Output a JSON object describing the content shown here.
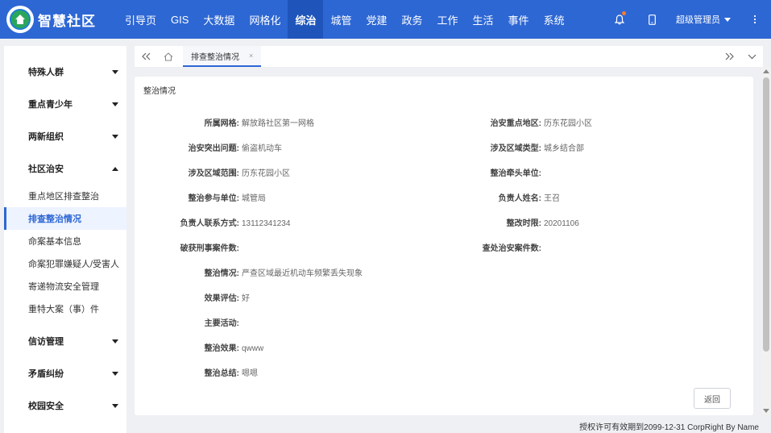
{
  "app": {
    "name": "智慧社区"
  },
  "nav": [
    "引导页",
    "GIS",
    "大数据",
    "网格化",
    "综治",
    "城管",
    "党建",
    "政务",
    "工作",
    "生活",
    "事件",
    "系统"
  ],
  "nav_active": "综治",
  "user": {
    "name": "超级管理员"
  },
  "sidebar": {
    "groups_top": [
      {
        "label": "特殊人群"
      },
      {
        "label": "重点青少年"
      },
      {
        "label": "两新组织"
      }
    ],
    "open_group": {
      "label": "社区治安"
    },
    "sub_items": [
      {
        "label": "重点地区排查整治"
      },
      {
        "label": "排查整治情况"
      },
      {
        "label": "命案基本信息"
      },
      {
        "label": "命案犯罪嫌疑人/受害人"
      },
      {
        "label": "寄递物流安全管理"
      },
      {
        "label": "重特大案（事）件"
      }
    ],
    "active_sub": "排查整治情况",
    "groups_bottom": [
      {
        "label": "信访管理"
      },
      {
        "label": "矛盾纠纷"
      },
      {
        "label": "校园安全"
      }
    ]
  },
  "tab": {
    "label": "排查整治情况",
    "close": "×"
  },
  "card": {
    "title": "整治情况",
    "fields": {
      "grid": {
        "label": "所属网格:",
        "value": "解放路社区第一网格"
      },
      "key_area": {
        "label": "治安重点地区:",
        "value": "历东花园小区"
      },
      "issue": {
        "label": "治安突出问题:",
        "value": "偷盗机动车"
      },
      "area_type": {
        "label": "涉及区域类型:",
        "value": "城乡结合部"
      },
      "area_range": {
        "label": "涉及区域范围:",
        "value": "历东花园小区"
      },
      "lead_unit": {
        "label": "整治牵头单位:",
        "value": ""
      },
      "join_unit": {
        "label": "整治参与单位:",
        "value": "城管局"
      },
      "owner": {
        "label": "负责人姓名:",
        "value": "王召"
      },
      "phone": {
        "label": "负责人联系方式:",
        "value": "13112341234"
      },
      "deadline": {
        "label": "整改时限:",
        "value": "20201106"
      },
      "criminal": {
        "label": "破获刑事案件数:",
        "value": ""
      },
      "security": {
        "label": "查处治安案件数:",
        "value": ""
      },
      "situation": {
        "label": "整治情况:",
        "value": "严查区域最近机动车频繁丢失现象"
      },
      "evaluation": {
        "label": "效果评估:",
        "value": "好"
      },
      "activity": {
        "label": "主要活动:",
        "value": ""
      },
      "effect": {
        "label": "整治效果:",
        "value": "qwww"
      },
      "summary": {
        "label": "整治总结:",
        "value": "嗯嗯"
      }
    },
    "back_button": "返回"
  },
  "footer": "授权许可有效期到2099-12-31 CorpRight By Name",
  "colors": {
    "primary": "#2d67d4",
    "nav_active": "#1f55bb",
    "notify_dot": "#ff7a2e"
  }
}
